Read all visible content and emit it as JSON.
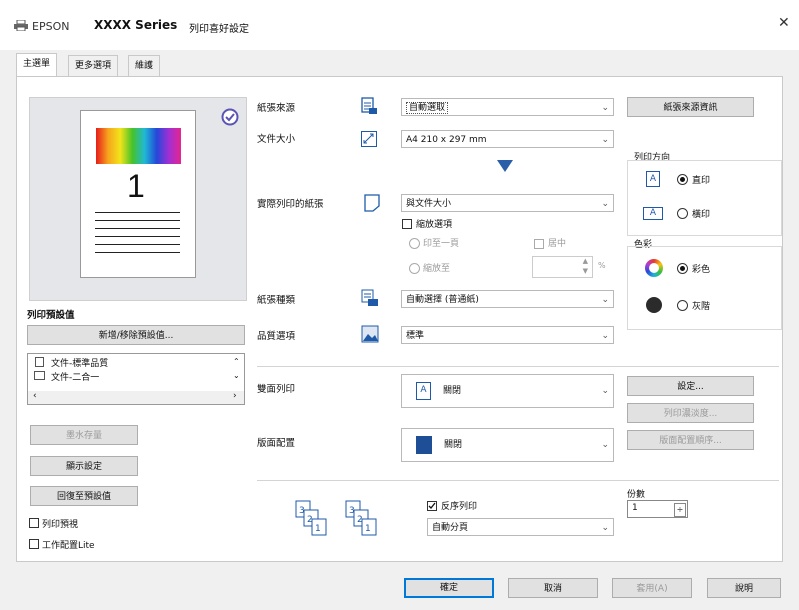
{
  "window": {
    "brand": "EPSON",
    "series": "XXXX Series",
    "title": "列印喜好設定",
    "close": "✕"
  },
  "tabs": [
    "主選單",
    "更多選項",
    "維護"
  ],
  "left": {
    "page_number": "1",
    "presets_title": "列印預設值",
    "add_remove_presets": "新增/移除預設值...",
    "preset_items": [
      "文件-標準品質",
      "文件-二合一"
    ],
    "show_ink_levels": "墨水存量",
    "show_settings": "顯示設定",
    "restore_defaults": "回復至預設值",
    "print_preview": "列印預視",
    "job_arranger": "工作配置Lite"
  },
  "main": {
    "paper_source_label": "紙張來源",
    "paper_source_value": "自動選取",
    "paper_source_info": "紙張來源資訊",
    "paper_size_label": "文件大小",
    "paper_size_value": "A4 210 x 297 mm",
    "output_paper_label": "實際列印的紙張",
    "output_paper_value": "與文件大小",
    "reduce_enlarge": "縮放選項",
    "fit_to_page": "印至一頁",
    "center": "居中",
    "zoom_to": "縮放至",
    "zoom_unit": "%",
    "paper_type_label": "紙張種類",
    "paper_type_value": "自動選擇 (普通紙)",
    "quality_label": "品質選項",
    "quality_value": "標準",
    "orientation_title": "列印方向",
    "portrait": "直印",
    "landscape": "橫印",
    "color_title": "色彩",
    "color": "彩色",
    "grayscale": "灰階",
    "duplex_label": "雙面列印",
    "duplex_value": "關閉",
    "duplex_settings": "設定...",
    "print_density": "列印濃淡度...",
    "multipage_label": "版面配置",
    "multipage_value": "關閉",
    "page_order": "版面配置順序...",
    "reverse_order": "反序列印",
    "collate_value": "自動分頁",
    "copies_label": "份數",
    "copies_value": "1"
  },
  "footer": {
    "ok": "確定",
    "cancel": "取消",
    "apply": "套用(A)",
    "help": "說明"
  }
}
